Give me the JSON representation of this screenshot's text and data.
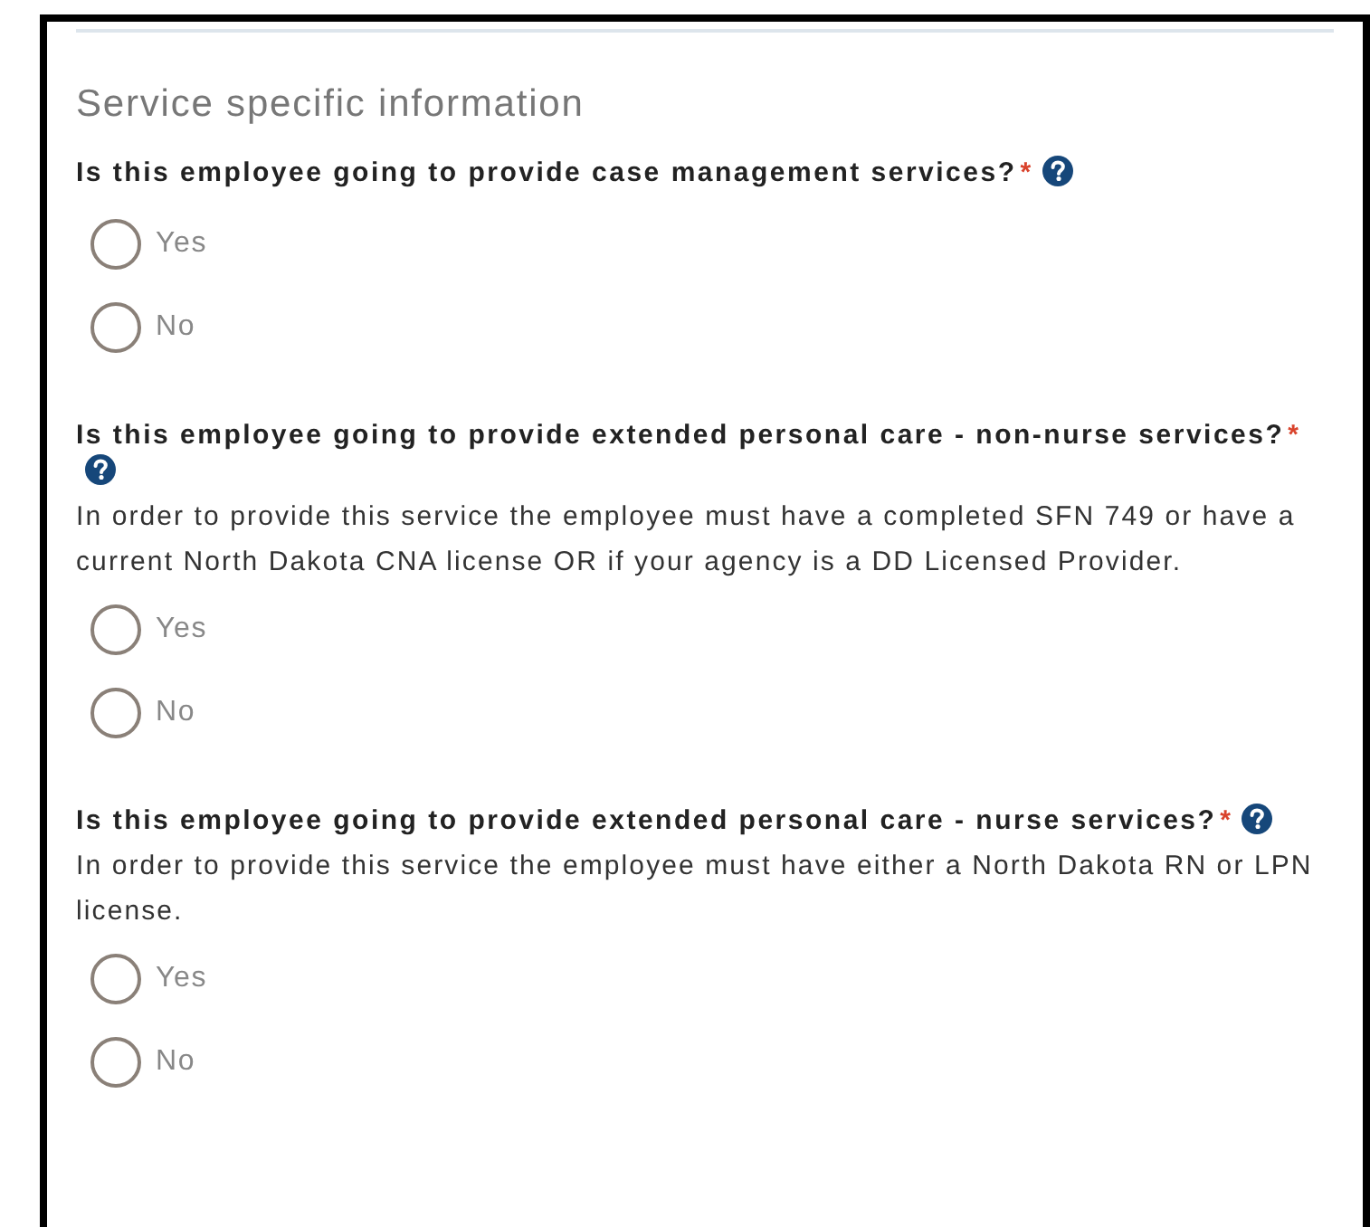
{
  "section_title": "Service specific information",
  "questions": [
    {
      "label": "Is this employee going to provide case management services?",
      "required_mark": "*",
      "help": true,
      "options": [
        {
          "label": "Yes",
          "selected": false
        },
        {
          "label": "No",
          "selected": false
        }
      ]
    },
    {
      "label": "Is this employee going to provide extended personal care - non-nurse services?",
      "required_mark": "*",
      "help": true,
      "description": "In order to provide this service the employee must have a completed SFN 749 or have a current North Dakota CNA license OR if your agency is a DD Licensed Provider.",
      "options": [
        {
          "label": "Yes",
          "selected": false
        },
        {
          "label": "No",
          "selected": false
        }
      ]
    },
    {
      "label": "Is this employee going to provide extended personal care - nurse services?",
      "required_mark": "*",
      "help": true,
      "description": "In order to provide this service the employee must have either a North Dakota RN or LPN license.",
      "options": [
        {
          "label": "Yes",
          "selected": false
        },
        {
          "label": "No",
          "selected": false
        }
      ]
    }
  ]
}
